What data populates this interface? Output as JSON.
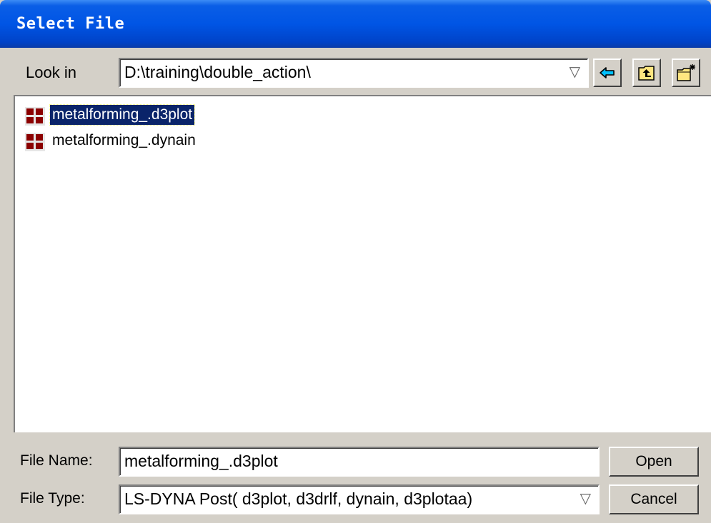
{
  "window": {
    "title": "Select File"
  },
  "look_in": {
    "label": "Look in",
    "path": "D:\\training\\double_action\\",
    "dropdown_arrow": "▽"
  },
  "toolbar": {
    "back_icon": "back-arrow-icon",
    "up_icon": "up-folder-icon",
    "new_folder_icon": "new-folder-icon"
  },
  "files": [
    {
      "name": "metalforming_.d3plot",
      "icon": "file-grid-icon",
      "selected": true
    },
    {
      "name": "metalforming_.dynain",
      "icon": "file-grid-icon",
      "selected": false
    }
  ],
  "file_name": {
    "label": "File Name:",
    "value": "metalforming_.d3plot"
  },
  "file_type": {
    "label": "File Type:",
    "value": "LS-DYNA Post( d3plot, d3drlf, dynain, d3plotaa)",
    "dropdown_arrow": "▽"
  },
  "buttons": {
    "open": "Open",
    "cancel": "Cancel"
  },
  "colors": {
    "titlebar": "#0055e5",
    "selection": "#0a246a",
    "dialog_bg": "#d4d0c8"
  }
}
